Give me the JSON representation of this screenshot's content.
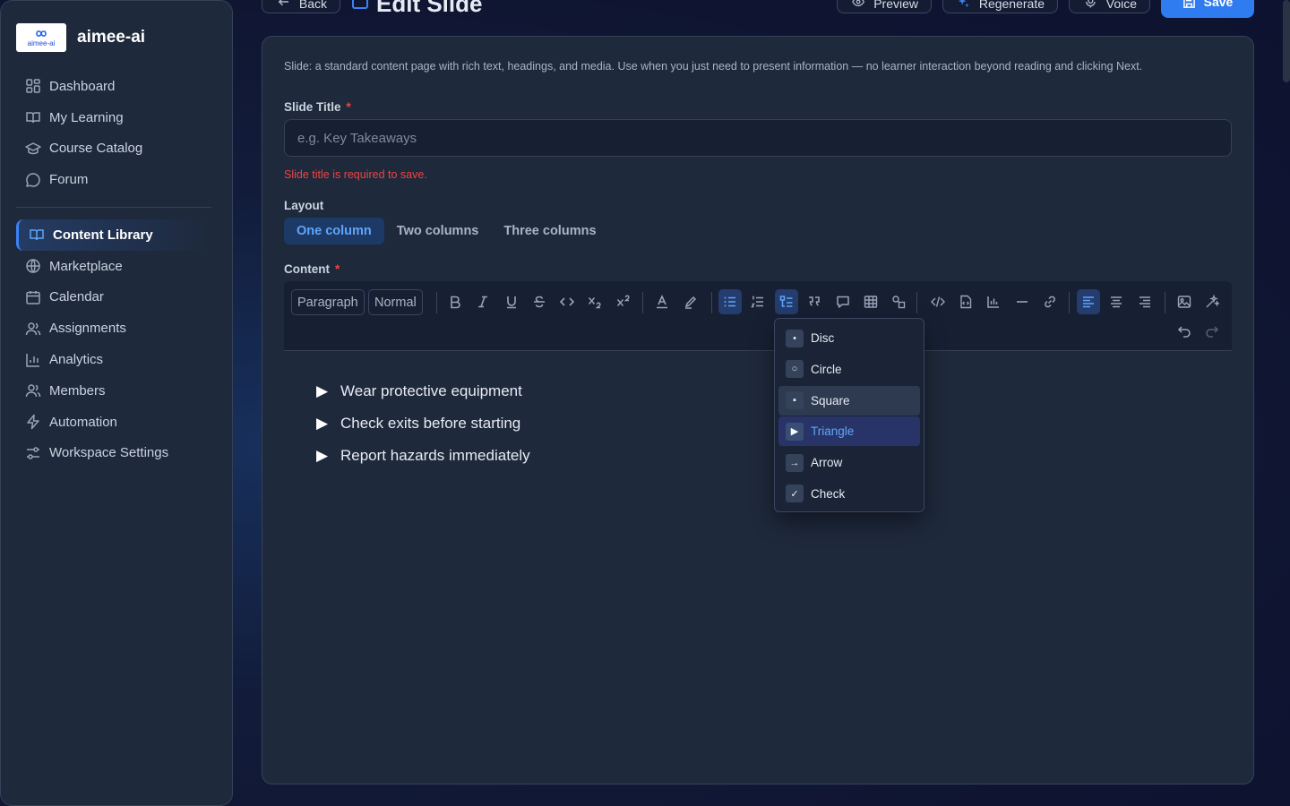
{
  "app": {
    "name": "aimee-ai",
    "logo_text": "aimee-ai"
  },
  "sidebar": {
    "top_items": [
      {
        "label": "Dashboard",
        "icon": "grid-icon"
      },
      {
        "label": "My Learning",
        "icon": "book-open-icon"
      },
      {
        "label": "Course Catalog",
        "icon": "graduation-cap-icon"
      },
      {
        "label": "Forum",
        "icon": "chat-bubble-icon"
      }
    ],
    "items": [
      {
        "label": "Content Library",
        "icon": "book-open-icon",
        "active": true
      },
      {
        "label": "Marketplace",
        "icon": "globe-icon"
      },
      {
        "label": "Calendar",
        "icon": "calendar-icon"
      },
      {
        "label": "Assignments",
        "icon": "users-icon"
      },
      {
        "label": "Analytics",
        "icon": "bar-chart-icon"
      },
      {
        "label": "Members",
        "icon": "users-icon"
      },
      {
        "label": "Automation",
        "icon": "lightning-icon"
      },
      {
        "label": "Workspace Settings",
        "icon": "sliders-icon"
      }
    ]
  },
  "header": {
    "back_label": "Back",
    "title": "Edit Slide",
    "preview_label": "Preview",
    "regenerate_label": "Regenerate",
    "voice_label": "Voice",
    "save_label": "Save"
  },
  "form": {
    "description": "Slide: a standard content page with rich text, headings, and media. Use when you just need to present information — no learner interaction beyond reading and clicking Next.",
    "slide_title_label": "Slide Title",
    "required_marker": "*",
    "slide_title_placeholder": "e.g. Key Takeaways",
    "slide_title_value": "",
    "slide_title_error": "Slide title is required to save.",
    "layout_label": "Layout",
    "layout_options": [
      "One column",
      "Two columns",
      "Three columns"
    ],
    "layout_selected": "One column",
    "content_label": "Content"
  },
  "toolbar": {
    "block_type": "Paragraph",
    "font_size": "Normal"
  },
  "editor": {
    "bullet_glyph": "▶",
    "list_items": [
      "Wear protective equipment",
      "Check exits before starting",
      "Report hazards immediately"
    ]
  },
  "bullet_menu": {
    "items": [
      {
        "label": "Disc",
        "mark": "•"
      },
      {
        "label": "Circle",
        "mark": "○"
      },
      {
        "label": "Square",
        "mark": "▪"
      },
      {
        "label": "Triangle",
        "mark": "▶"
      },
      {
        "label": "Arrow",
        "mark": "→"
      },
      {
        "label": "Check",
        "mark": "✓"
      }
    ],
    "selected": "Triangle",
    "hovered": "Square"
  },
  "colors": {
    "accent": "#3b82f6",
    "error": "#ef4444",
    "panel": "#1e293b"
  }
}
